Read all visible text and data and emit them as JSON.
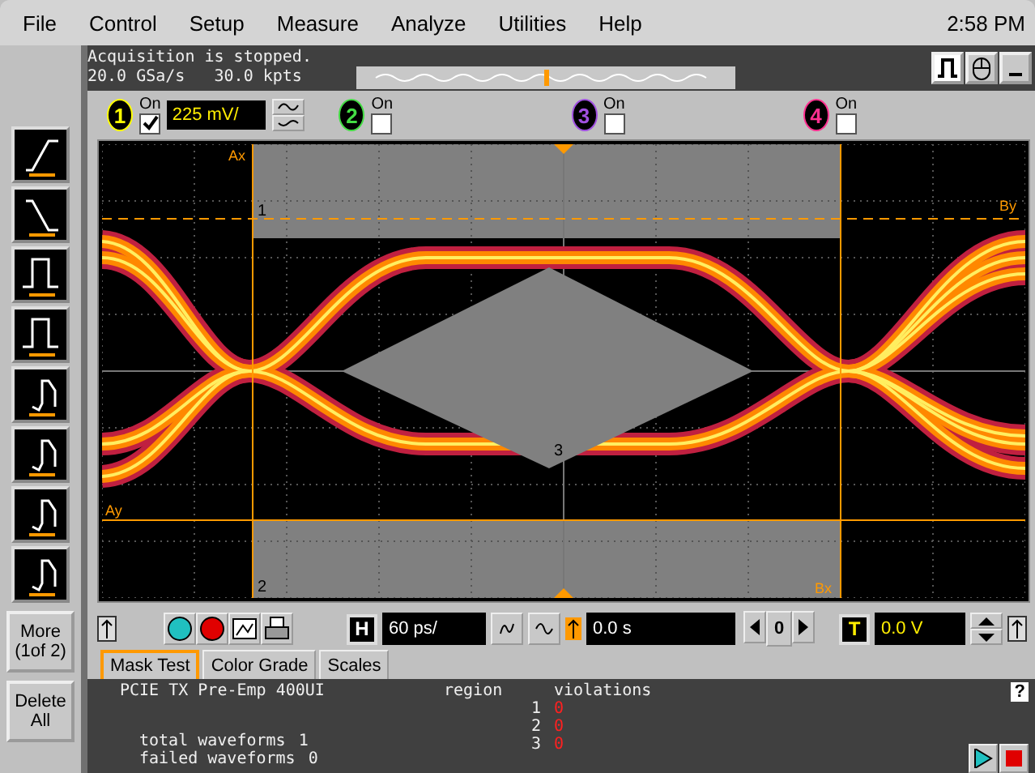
{
  "menu": [
    "File",
    "Control",
    "Setup",
    "Measure",
    "Analyze",
    "Utilities",
    "Help"
  ],
  "clock": "2:58 PM",
  "status": [
    "Acquisition is stopped.",
    "20.0 GSa/s   30.0 kpts"
  ],
  "channels": [
    {
      "number": "1",
      "on_label": "On",
      "on": true,
      "scale": "225 mV/",
      "color": "#ffff00"
    },
    {
      "number": "2",
      "on_label": "On",
      "on": false,
      "color": "#44dd44"
    },
    {
      "number": "3",
      "on_label": "On",
      "on": false,
      "color": "#a050e0"
    },
    {
      "number": "4",
      "on_label": "On",
      "on": false,
      "color": "#ff3090"
    }
  ],
  "side_buttons": [
    [
      "More",
      "(1of 2)"
    ],
    [
      "Delete",
      "All"
    ]
  ],
  "markers": {
    "ax": "Ax",
    "bx": "Bx",
    "ay": "Ay",
    "by": "By"
  },
  "region_labels": [
    "1",
    "2",
    "3"
  ],
  "horizontal": {
    "label": "H",
    "scale": "60 ps/",
    "position": "0.0 s",
    "zoom": "0"
  },
  "trigger": {
    "label": "T",
    "level": "0.0 V"
  },
  "tabs": [
    {
      "label": "Mask Test",
      "selected": true
    },
    {
      "label": "Color Grade",
      "selected": false
    },
    {
      "label": "Scales",
      "selected": false
    }
  ],
  "mask_test": {
    "mask_name": "PCIE TX Pre-Emp 400UI",
    "headers": [
      "region",
      "violations"
    ],
    "regions": [
      {
        "region": "1",
        "violations": "0"
      },
      {
        "region": "2",
        "violations": "0"
      },
      {
        "region": "3",
        "violations": "0"
      }
    ],
    "totals": [
      {
        "label": "total waveforms",
        "value": "1"
      },
      {
        "label": "failed waveforms",
        "value": "0"
      }
    ],
    "help": "?"
  }
}
